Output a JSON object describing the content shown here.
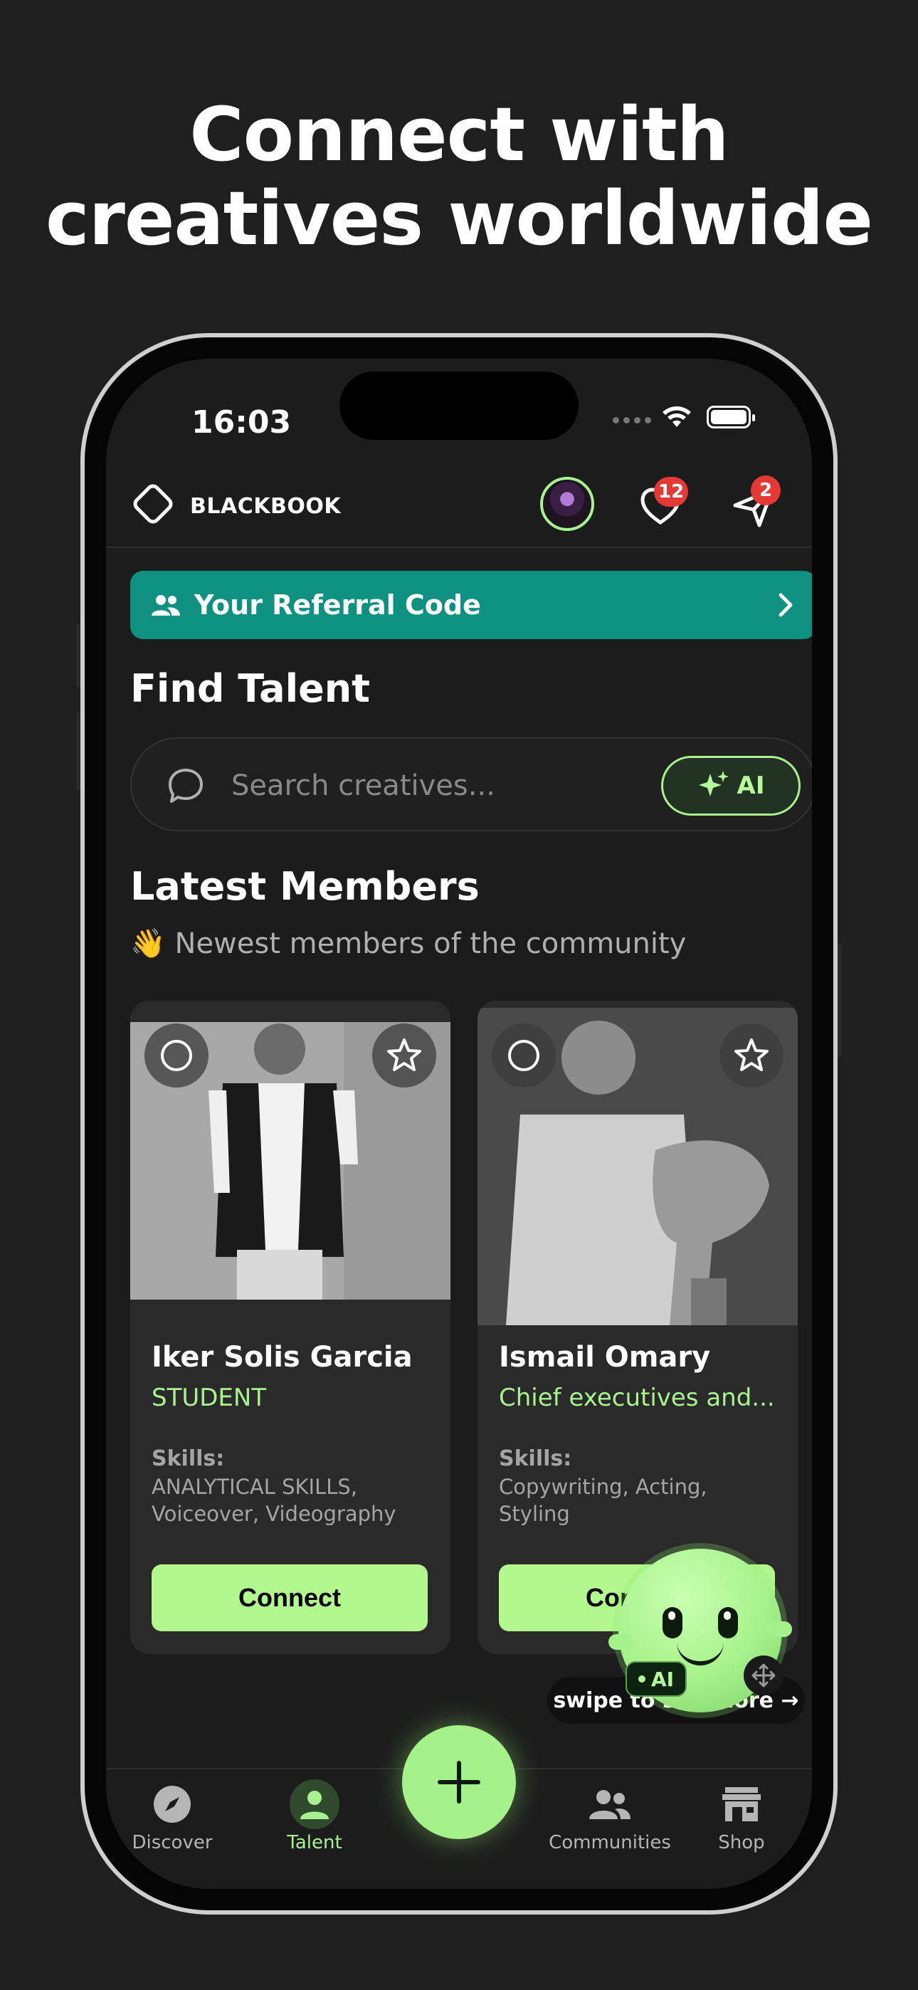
{
  "headline": {
    "line1": "Connect with",
    "line2": "creatives worldwide"
  },
  "status_bar": {
    "time": "16:03"
  },
  "header": {
    "brand": "BLACKBOOK",
    "likes_badge": "12",
    "messages_badge": "2"
  },
  "referral": {
    "label": "Your Referral Code"
  },
  "find_talent": {
    "title": "Find Talent",
    "search_placeholder": "Search creatives...",
    "ai_label": "AI"
  },
  "latest": {
    "title": "Latest Members",
    "subtitle": "👋 Newest members of the community",
    "members": [
      {
        "name": "Iker Solis Garcia",
        "role": "STUDENT",
        "skills_label": "Skills:",
        "skills": "ANALYTICAL SKILLS, Voiceover, Videography",
        "connect_label": "Connect"
      },
      {
        "name": "Ismail Omary",
        "role": "Chief executives and...",
        "skills_label": "Skills:",
        "skills": "Copywriting, Acting, Styling",
        "connect_label": "Connect"
      }
    ],
    "swipe_hint": "swipe to see more →"
  },
  "assistant": {
    "tag": "AI"
  },
  "tabbar": {
    "tabs": [
      {
        "label": "Discover",
        "icon": "compass-icon"
      },
      {
        "label": "Talent",
        "icon": "person-icon",
        "active": true
      },
      {
        "label": "Communities",
        "icon": "people-icon"
      },
      {
        "label": "Shop",
        "icon": "store-icon"
      }
    ]
  },
  "colors": {
    "accent": "#a8f28f",
    "referral": "#0f9182",
    "background": "#1f1f1f",
    "badge": "#e53935"
  }
}
